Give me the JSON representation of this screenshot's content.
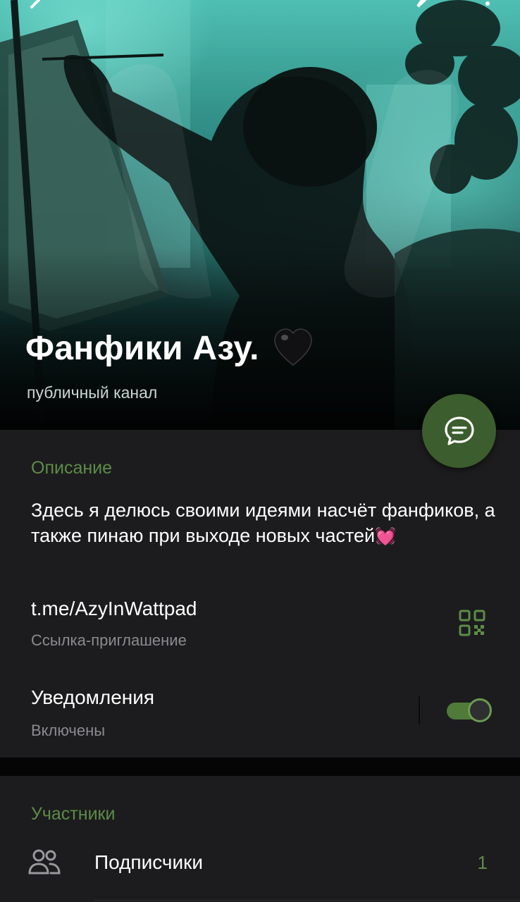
{
  "header": {
    "title": "Фанфики Азу.",
    "subtitle": "публичный канал"
  },
  "icons": {
    "back": "back-arrow-icon",
    "edit": "pencil-icon",
    "more": "more-vertical-icon",
    "heart": "black-heart-icon",
    "message": "message-icon",
    "qr": "qr-code-icon",
    "people": "people-icon"
  },
  "info": {
    "description_label": "Описание",
    "description_text": "Здесь я делюсь своими идеями насчёт фанфиков, а также пинаю при выходе новых частей",
    "description_emoji": "💓",
    "link": "t.me/AzyInWattpad",
    "link_caption": "Ссылка-приглашение",
    "notifications_label": "Уведомления",
    "notifications_status": "Включены",
    "notifications_on": true
  },
  "members": {
    "section_label": "Участники",
    "subscribers_label": "Подписчики",
    "subscribers_count": "1"
  },
  "colors": {
    "accent": "#5c8c48",
    "fab": "#3c5d2d",
    "panel": "#1c1c1e"
  }
}
